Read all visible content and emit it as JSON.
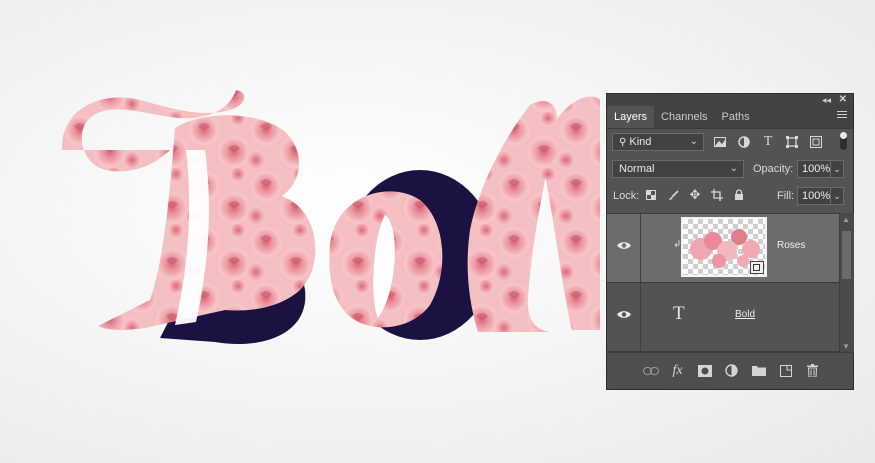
{
  "canvas": {
    "artwork_text": "Bold",
    "colors": {
      "rose_light": "#f6c4c6",
      "rose_mid": "#ea8f98",
      "rose_deep": "#d46a78",
      "navy_fill": "#1c1242",
      "background": "#f2f2f2"
    }
  },
  "panel": {
    "tabs": [
      {
        "label": "Layers",
        "active": true
      },
      {
        "label": "Channels",
        "active": false
      },
      {
        "label": "Paths",
        "active": false
      }
    ],
    "filter": {
      "kind_label": "Kind"
    },
    "filter_icons": [
      "image-filter-icon",
      "adjustment-filter-icon",
      "type-filter-icon",
      "shape-filter-icon",
      "smart-object-filter-icon"
    ],
    "blend_mode": "Normal",
    "opacity_label": "Opacity:",
    "opacity_value": "100%",
    "lock_label": "Lock:",
    "lock_icons": [
      "lock-transparent-icon",
      "lock-paint-icon",
      "lock-move-icon",
      "lock-artboard-icon",
      "lock-all-icon"
    ],
    "fill_label": "Fill:",
    "fill_value": "100%",
    "layers": [
      {
        "name": "Roses",
        "type": "smart-object",
        "selected": true,
        "clipped": true,
        "visible": true
      },
      {
        "name": "Bold",
        "type": "text",
        "selected": false,
        "clipped": false,
        "visible": true
      }
    ],
    "bottom_icons": [
      "link-layers-icon",
      "fx-icon",
      "add-mask-icon",
      "adjustment-layer-icon",
      "new-group-icon",
      "new-layer-icon",
      "trash-icon"
    ],
    "colors": {
      "panel_bg": "#535353",
      "tab_bar": "#424242",
      "selected_row": "#6c6c6c",
      "input_bg": "#424242"
    }
  }
}
